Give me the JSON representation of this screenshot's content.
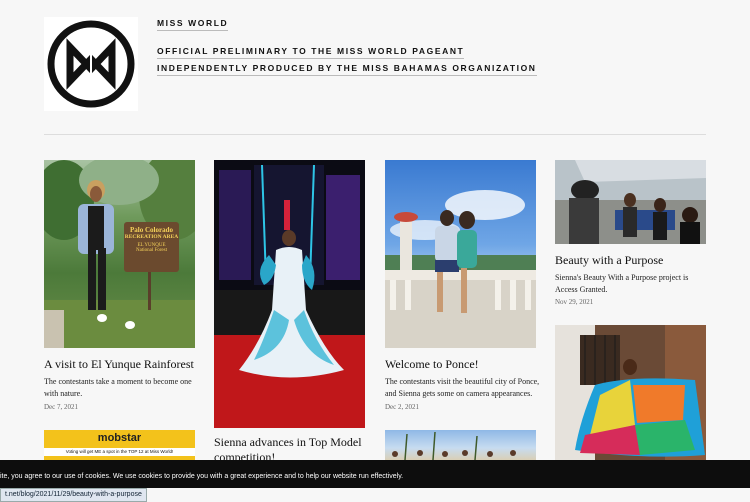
{
  "header": {
    "brand_title": "MISS WORLD",
    "line1": "OFFICIAL PRELIMINARY TO THE MISS WORLD PAGEANT",
    "line2": "INDEPENDENTLY PRODUCED BY THE MISS BAHAMAS ORGANIZATION"
  },
  "posts": [
    {
      "title": "A visit to El Yunque Rainforest",
      "excerpt": "The contestants take a moment to become one with nature.",
      "date": "Dec 7, 2021",
      "sign": [
        "Palo Colorado",
        "RECREATION AREA",
        "EL YUNQUE",
        "National Forest"
      ]
    },
    {
      "title": "Sienna advances in Top Model competition!"
    },
    {
      "title": "Welcome to Ponce!",
      "excerpt": "The contestants visit the beautiful city of Ponce, and Sienna gets some on camera appearances.",
      "date": "Dec 2, 2021"
    },
    {
      "title": "Beauty with a Purpose",
      "excerpt": "Sienna's Beauty With a Purpose project is Access Granted.",
      "date": "Nov 29, 2021"
    }
  ],
  "promo": {
    "brand": "mobstar",
    "caption": "Voting will get ME a spot in the TOP 12 at Miss World!"
  },
  "cookie_banner": {
    "text": "ite, you agree to our use of cookies. We use cookies to provide you with a great experience and to help our website run effectively."
  },
  "status_bar": {
    "url": "t.net/blog/2021/11/29/beauty-with-a-purpose"
  },
  "colors": {
    "background": "#f7f7f7",
    "cookie_bar": "#0d0d0d",
    "runway_floor": "#c0171a",
    "promo_yellow": "#f3c21b"
  }
}
